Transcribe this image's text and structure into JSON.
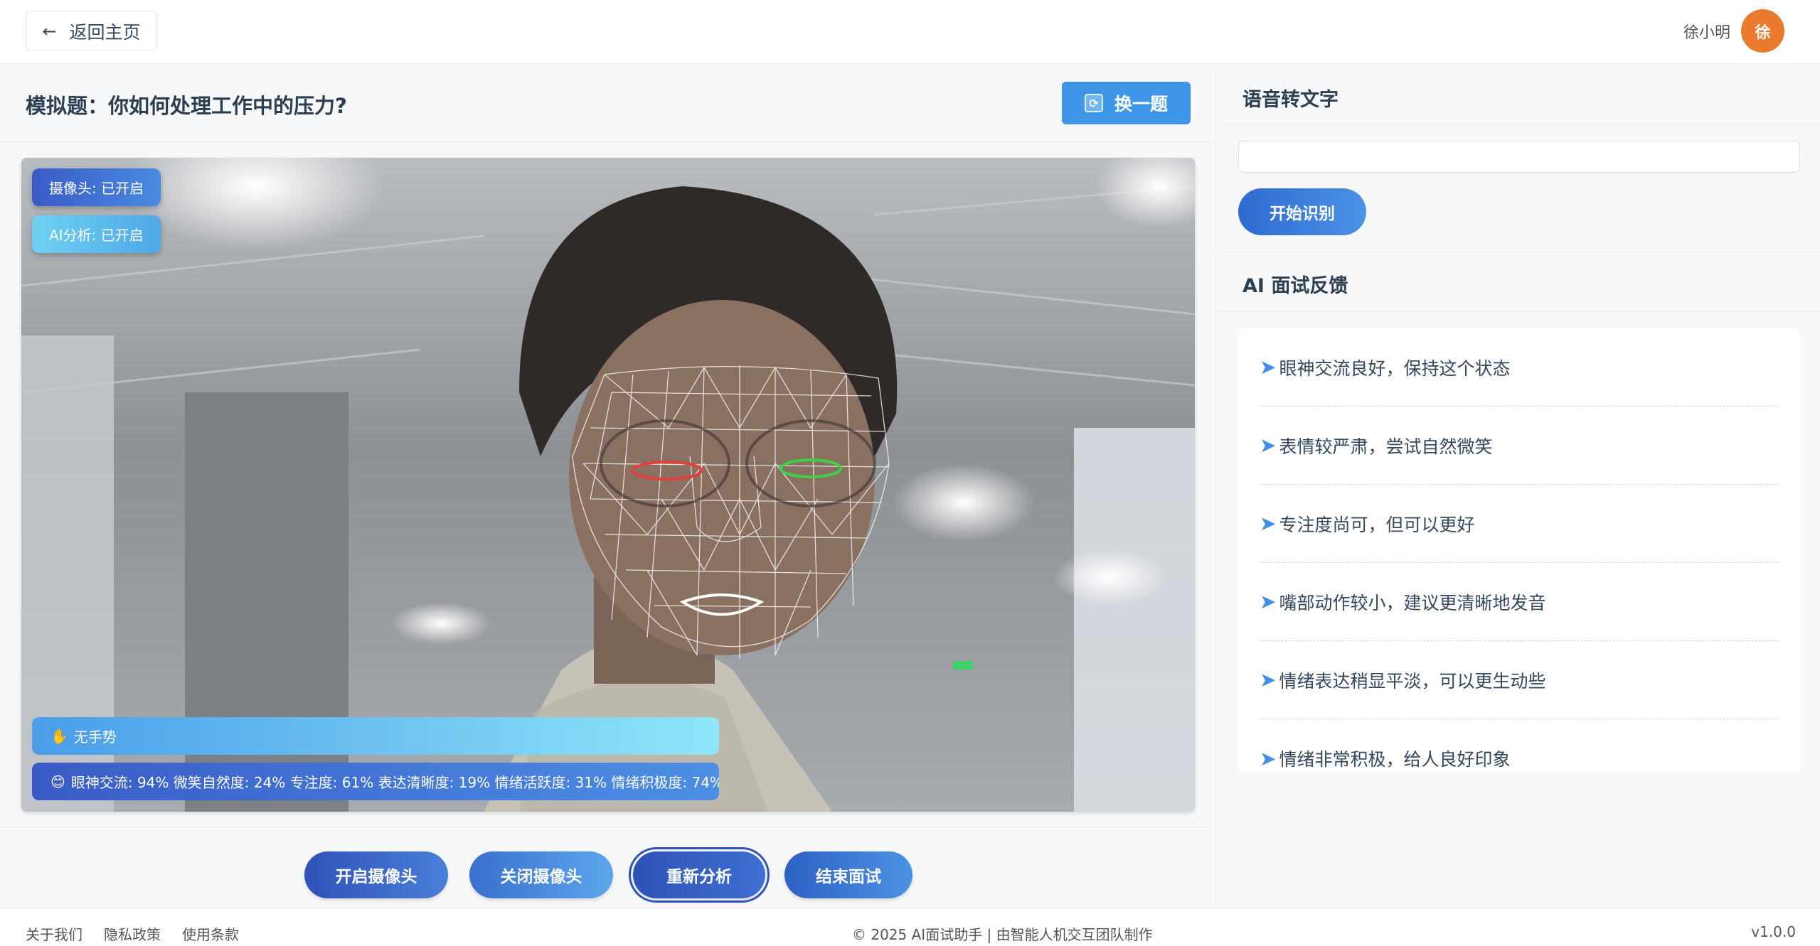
{
  "header": {
    "back_label": "返回主页",
    "user_name": "徐小明",
    "avatar_initial": "徐"
  },
  "question": {
    "title": "模拟题：你如何处理工作中的压力?",
    "swap_label": "换一题"
  },
  "video": {
    "camera_status": "摄像头: 已开启",
    "ai_status": "AI分析: 已开启",
    "gesture_icon": "raised-hand-icon",
    "gesture_text": "无手势",
    "metrics_icon": "smiley-icon",
    "metrics_text": "眼神交流: 94% 微笑自然度: 24% 专注度: 61% 表达清晰度: 19% 情绪活跃度: 31% 情绪积极度: 74%"
  },
  "controls": {
    "open_camera": "开启摄像头",
    "close_camera": "关闭摄像头",
    "reanalyze": "重新分析",
    "end_interview": "结束面试"
  },
  "speech": {
    "title": "语音转文字",
    "input_value": "",
    "start_label": "开始识别"
  },
  "feedback": {
    "title": "AI 面试反馈",
    "arrow": "➤",
    "items": [
      "眼神交流良好，保持这个状态",
      "表情较严肃，尝试自然微笑",
      "专注度尚可，但可以更好",
      "嘴部动作较小，建议更清晰地发音",
      "情绪表达稍显平淡，可以更生动些",
      "情绪非常积极，给人良好印象"
    ]
  },
  "footer": {
    "links": [
      "关于我们",
      "隐私政策",
      "使用条款"
    ],
    "copyright": "© 2025 AI面试助手 | 由智能人机交互团队制作",
    "version": "v1.0.0"
  },
  "colors": {
    "accent": "#3f96e8",
    "avatar": "#ea7a2e",
    "left_eye_outline": "#e04040",
    "right_eye_outline": "#3fd04a"
  }
}
